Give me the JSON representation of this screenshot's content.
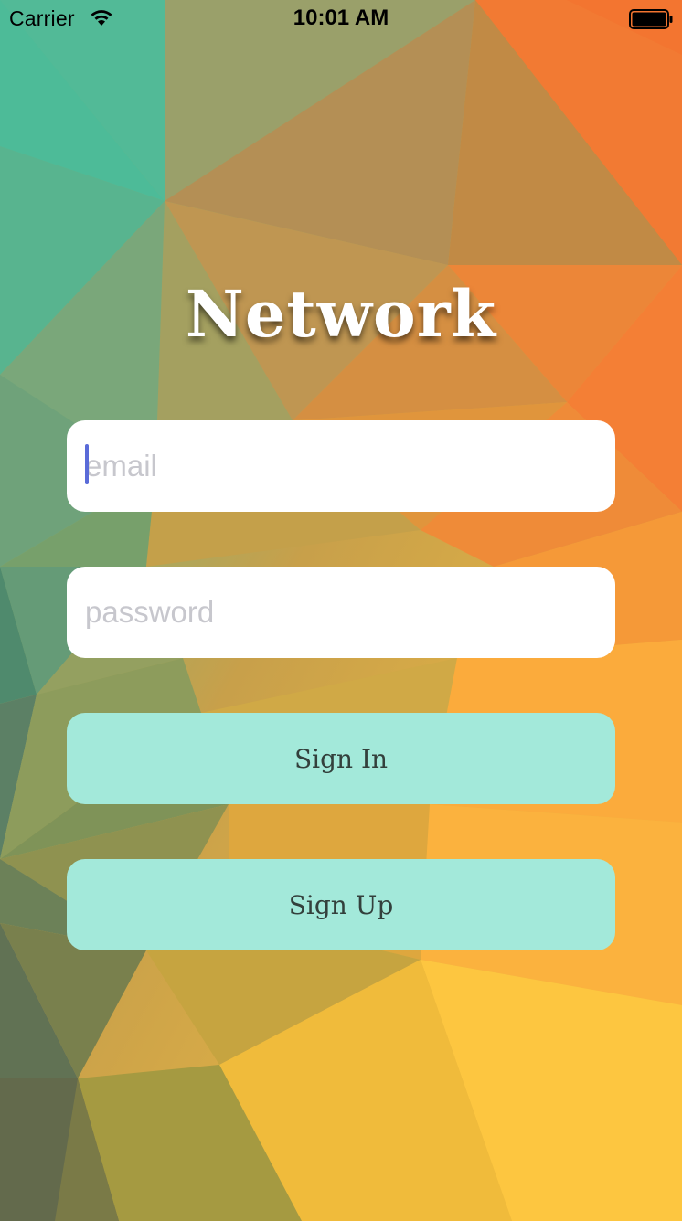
{
  "status_bar": {
    "carrier": "Carrier",
    "time": "10:01 AM",
    "wifi_icon": "wifi-icon",
    "battery_icon": "battery-icon"
  },
  "app": {
    "title": "Network"
  },
  "form": {
    "email_placeholder": "email",
    "password_placeholder": "password",
    "sign_in_label": "Sign In",
    "sign_up_label": "Sign Up"
  },
  "colors": {
    "button": "#a3e9da",
    "button_text": "#33403c",
    "caret": "#5a6bd8",
    "bg_teal": "#4fbf9a",
    "bg_orange": "#f47a30",
    "bg_yellow": "#fcc43f"
  }
}
